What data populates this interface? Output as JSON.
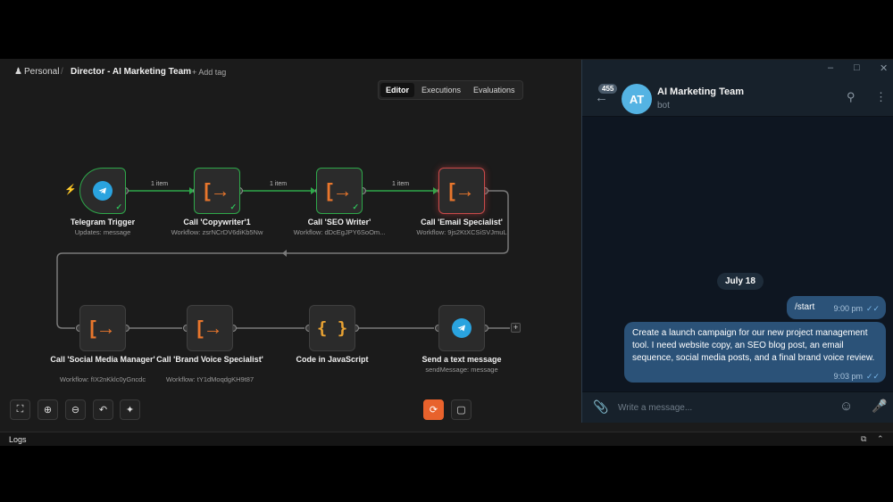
{
  "breadcrumb": {
    "user_icon": "user-icon",
    "workspace": "Personal",
    "separator": "/",
    "workflow_title": "Director - AI Marketing Team",
    "add_tag": "+ Add tag"
  },
  "tabs": [
    {
      "label": "Editor",
      "active": true
    },
    {
      "label": "Executions",
      "active": false
    },
    {
      "label": "Evaluations",
      "active": false
    }
  ],
  "nodes": [
    {
      "title": "Telegram Trigger",
      "subtitle": "Updates: message",
      "icon": "telegram-icon",
      "status": "success"
    },
    {
      "title": "Call 'Copywriter'1",
      "subtitle": "Workflow: zsrNCrDV6diKb5Nw",
      "icon": "arrow-right-from-bracket-icon",
      "status": "success"
    },
    {
      "title": "Call 'SEO Writer'",
      "subtitle": "Workflow: dDcEgJPY6SoOm...",
      "icon": "arrow-right-from-bracket-icon",
      "status": "success"
    },
    {
      "title": "Call 'Email Specialist'",
      "subtitle": "Workflow: 9js2KtXCSiSVJmuL",
      "icon": "arrow-right-from-bracket-icon",
      "status": "running"
    },
    {
      "title": "Call 'Social Media Manager'",
      "subtitle": "Workflow: fIX2nKklc0yGncdc",
      "icon": "arrow-right-from-bracket-icon",
      "status": "idle"
    },
    {
      "title": "Call 'Brand Voice Specialist'",
      "subtitle": "Workflow: tY1dMoqdgKH9t87",
      "icon": "arrow-right-from-bracket-icon",
      "status": "idle"
    },
    {
      "title": "Code in JavaScript",
      "subtitle": "",
      "icon": "code-braces-icon",
      "status": "idle"
    },
    {
      "title": "Send a text message",
      "subtitle": "sendMessage: message",
      "icon": "telegram-icon",
      "status": "idle"
    }
  ],
  "edge_labels": [
    "1 item",
    "1 item",
    "1 item"
  ],
  "add_node_symbol": "+",
  "logs": {
    "label": "Logs"
  },
  "telegram": {
    "unread_count": "455",
    "chat_name": "AI Marketing Team",
    "chat_status": "bot",
    "avatar_initials": "AT",
    "date_separator": "July 18",
    "messages": [
      {
        "text": "/start",
        "time": "9:00 pm"
      },
      {
        "text": "Create a launch campaign for our new project management tool. I need website copy, an SEO blog post, an email sequence, social media posts, and a final brand voice review.",
        "time": "9:03 pm"
      }
    ],
    "composer_placeholder": "Write a message..."
  },
  "colors": {
    "success": "#2ea84a",
    "error_glow": "#c94a4a",
    "accent_orange": "#e8622c",
    "telegram_blue": "#2aa3df",
    "bubble": "#2b5278"
  }
}
